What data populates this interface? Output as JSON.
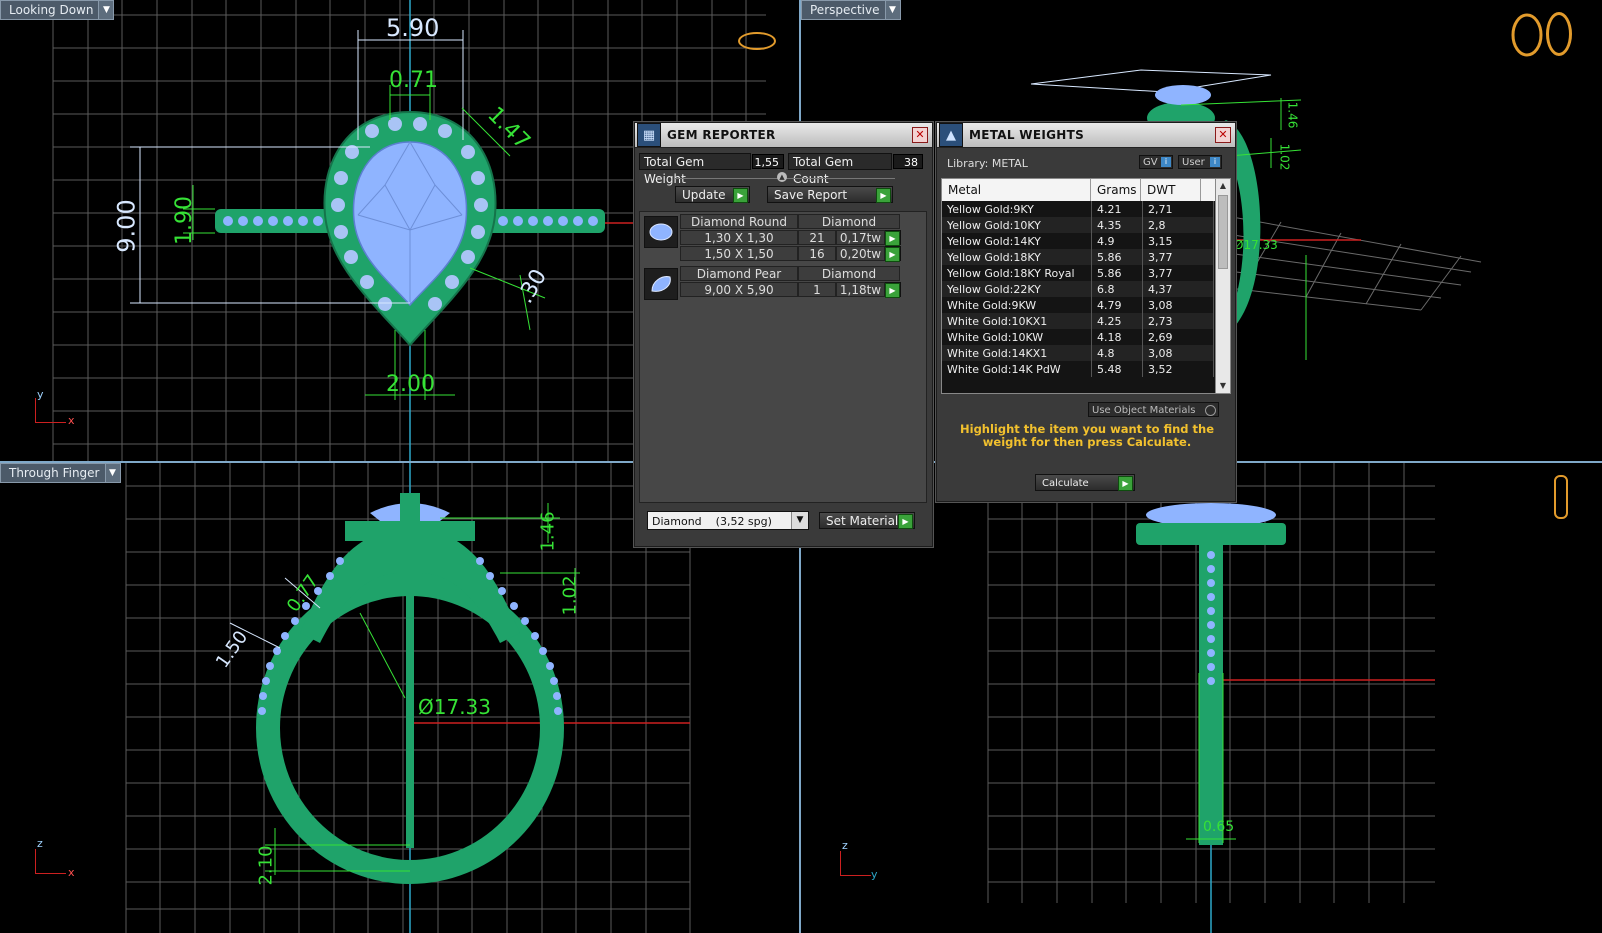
{
  "viewports": {
    "top_left": {
      "label": "Looking Down",
      "axis_y": "y",
      "axis_x": "x"
    },
    "top_right": {
      "label": "Perspective"
    },
    "bottom_left": {
      "label": "Through Finger",
      "axis_y": "z",
      "axis_x": "x"
    },
    "bottom_right": {
      "axis_y": "z",
      "axis_x": "y"
    }
  },
  "dimensions": {
    "looking_down": [
      "5.90",
      "0.71",
      "1.47",
      "9.00",
      "1.90",
      ".30",
      "2.00"
    ],
    "through_finger": [
      "1.46",
      "1.02",
      "0.77",
      "1.50",
      "Ø17.33",
      "2.10"
    ],
    "perspective": [
      "1.46",
      "1.02",
      "Ø17.33"
    ],
    "side": [
      "0.65"
    ]
  },
  "gem_reporter": {
    "title": "GEM REPORTER",
    "total_weight_label": "Total Gem Weight",
    "total_weight_value": "1,55",
    "total_count_label": "Total Gem Count",
    "total_count_value": "38",
    "update_label": "Update",
    "save_report_label": "Save Report",
    "groups": [
      {
        "name": "Diamond Round",
        "material": "Diamond",
        "rows": [
          {
            "size": "1,30 X 1,30",
            "count": "21",
            "weight": "0,17tw"
          },
          {
            "size": "1,50 X 1,50",
            "count": "16",
            "weight": "0,20tw"
          }
        ]
      },
      {
        "name": "Diamond Pear",
        "material": "Diamond",
        "rows": [
          {
            "size": "9,00 X 5,90",
            "count": "1",
            "weight": "1,18tw"
          }
        ]
      }
    ],
    "material_select": "Diamond    (3,52 spg)",
    "set_material_label": "Set Material"
  },
  "metal_weights": {
    "title": "METAL WEIGHTS",
    "library": "Library: METAL",
    "gv_label": "GV",
    "user_label": "User",
    "columns": [
      "Metal",
      "Grams",
      "DWT"
    ],
    "rows": [
      [
        "Yellow Gold:9KY",
        "4.21",
        "2,71"
      ],
      [
        "Yellow Gold:10KY",
        "4.35",
        "2,8"
      ],
      [
        "Yellow Gold:14KY",
        "4.9",
        "3,15"
      ],
      [
        "Yellow Gold:18KY",
        "5.86",
        "3,77"
      ],
      [
        "Yellow Gold:18KY Royal",
        "5.86",
        "3,77"
      ],
      [
        "Yellow Gold:22KY",
        "6.8",
        "4,37"
      ],
      [
        "White Gold:9KW",
        "4.79",
        "3,08"
      ],
      [
        "White Gold:10KX1",
        "4.25",
        "2,73"
      ],
      [
        "White Gold:10KW",
        "4.18",
        "2,69"
      ],
      [
        "White Gold:14KX1",
        "4.8",
        "3,08"
      ],
      [
        "White Gold:14K PdW",
        "5.48",
        "3,52"
      ]
    ],
    "use_object_materials": "Use Object Materials",
    "hint": "Highlight the item you want to find the weight for then press Calculate.",
    "calculate_label": "Calculate"
  },
  "colors": {
    "ring": "#1fa36a",
    "dimension": "#36e236",
    "gem": "#8fb4ff",
    "view_label": "#4c5a69"
  }
}
